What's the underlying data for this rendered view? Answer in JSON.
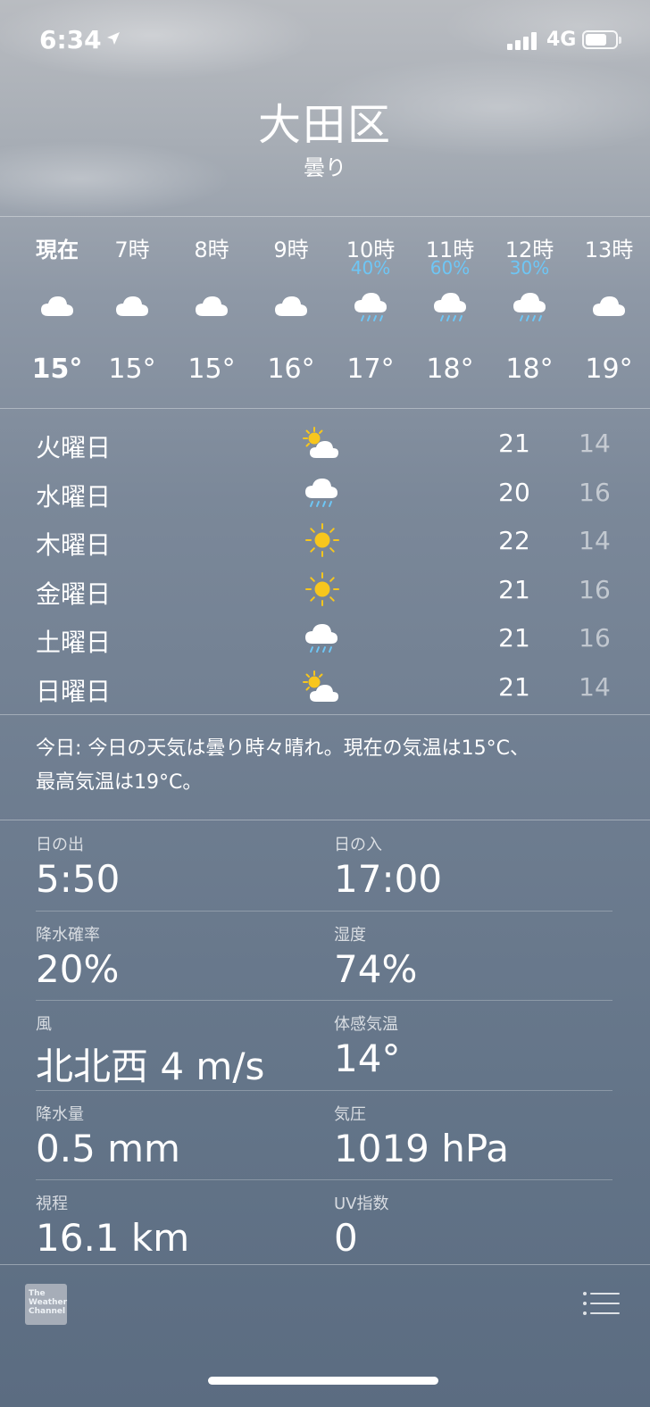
{
  "status": {
    "time": "6:34",
    "network": "4G"
  },
  "location": {
    "city": "大田区",
    "condition": "曇り"
  },
  "hourly": [
    {
      "label": "現在",
      "pop": "",
      "icon": "cloud-icon",
      "temp": "15°"
    },
    {
      "label": "7時",
      "pop": "",
      "icon": "cloud-icon",
      "temp": "15°"
    },
    {
      "label": "8時",
      "pop": "",
      "icon": "cloud-icon",
      "temp": "15°"
    },
    {
      "label": "9時",
      "pop": "",
      "icon": "cloud-icon",
      "temp": "16°"
    },
    {
      "label": "10時",
      "pop": "40%",
      "icon": "cloud-rain-icon",
      "temp": "17°"
    },
    {
      "label": "11時",
      "pop": "60%",
      "icon": "cloud-rain-icon",
      "temp": "18°"
    },
    {
      "label": "12時",
      "pop": "30%",
      "icon": "cloud-rain-icon",
      "temp": "18°"
    },
    {
      "label": "13時",
      "pop": "",
      "icon": "cloud-icon",
      "temp": "19°"
    }
  ],
  "daily": [
    {
      "day": "火曜日",
      "icon": "partly-sunny-icon",
      "high": "21",
      "low": "14"
    },
    {
      "day": "水曜日",
      "icon": "cloud-rain-icon",
      "high": "20",
      "low": "16"
    },
    {
      "day": "木曜日",
      "icon": "sun-icon",
      "high": "22",
      "low": "14"
    },
    {
      "day": "金曜日",
      "icon": "sun-icon",
      "high": "21",
      "low": "16"
    },
    {
      "day": "土曜日",
      "icon": "cloud-rain-icon",
      "high": "21",
      "low": "16"
    },
    {
      "day": "日曜日",
      "icon": "partly-sunny-icon",
      "high": "21",
      "low": "14"
    }
  ],
  "summary": {
    "line1": "今日: 今日の天気は曇り時々晴れ。現在の気温は15°C、",
    "line2": "最高気温は19°C。"
  },
  "details": [
    {
      "left": {
        "label": "日の出",
        "value": "5:50"
      },
      "right": {
        "label": "日の入",
        "value": "17:00"
      }
    },
    {
      "left": {
        "label": "降水確率",
        "value": "20%"
      },
      "right": {
        "label": "湿度",
        "value": "74%"
      }
    },
    {
      "left": {
        "label": "風",
        "value": "北北西 4 m/s"
      },
      "right": {
        "label": "体感気温",
        "value": "14°"
      }
    },
    {
      "left": {
        "label": "降水量",
        "value": "0.5 mm"
      },
      "right": {
        "label": "気圧",
        "value": "1019 hPa"
      }
    },
    {
      "left": {
        "label": "視程",
        "value": "16.1 km"
      },
      "right": {
        "label": "UV指数",
        "value": "0"
      }
    }
  ],
  "footer": {
    "logo_line1": "The",
    "logo_line2": "Weather",
    "logo_line3": "Channel"
  },
  "colors": {
    "precip": "#6ec6f5",
    "sun": "#f7c61d"
  }
}
